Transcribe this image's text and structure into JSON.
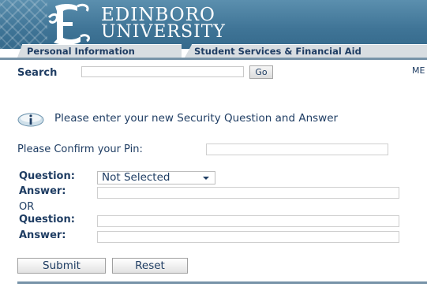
{
  "header": {
    "logo_line1": "EDINBORO",
    "logo_line2": "UNIVERSITY"
  },
  "tabs": [
    {
      "label": "Personal Information"
    },
    {
      "label": "Student Services & Financial Aid"
    }
  ],
  "search": {
    "label": "Search",
    "value": "",
    "go_label": "Go",
    "menu_link": "ME"
  },
  "info": {
    "icon": "info-icon",
    "message": "Please enter your new Security Question and Answer"
  },
  "form": {
    "pin_label": "Please Confirm your Pin:",
    "pin_value": "",
    "question1_label": "Question:",
    "question1_selected": "Not Selected",
    "answer1_label": "Answer:",
    "answer1_value": "",
    "or_label": "OR",
    "question2_label": "Question:",
    "question2_value": "",
    "answer2_label": "Answer:",
    "answer2_value": "",
    "submit_label": "Submit",
    "reset_label": "Reset"
  },
  "colors": {
    "banner": "#3f7496",
    "tab_bg": "#d8dde1",
    "text": "#1f3d63",
    "rule": "#7793a8"
  }
}
